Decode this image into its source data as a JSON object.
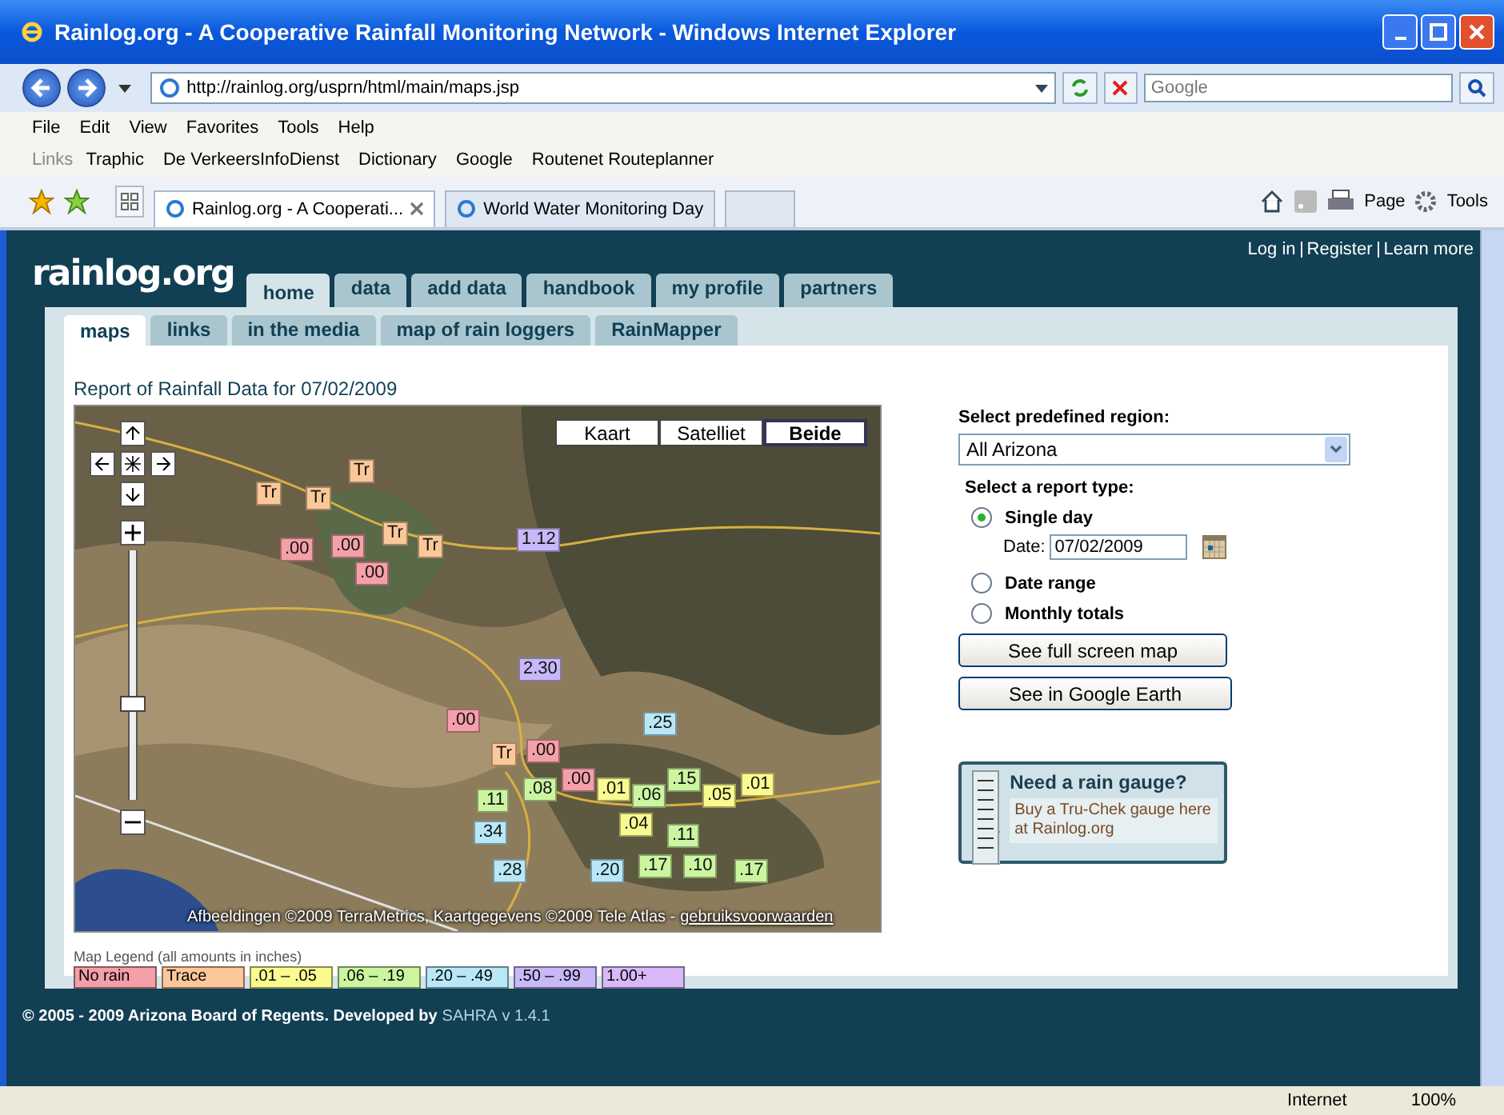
{
  "window": {
    "title": "Rainlog.org - A Cooperative Rainfall Monitoring Network - Windows Internet Explorer"
  },
  "address_bar": {
    "url": "http://rainlog.org/usprn/html/main/maps.jsp"
  },
  "search": {
    "placeholder": "Google"
  },
  "menu": [
    "File",
    "Edit",
    "View",
    "Favorites",
    "Tools",
    "Help"
  ],
  "links_bar": {
    "label": "Links",
    "items": [
      "Traphic",
      "De VerkeersInfoDienst",
      "Dictionary",
      "Google",
      "Routenet Routeplanner"
    ]
  },
  "browser_tabs": [
    {
      "title": "Rainlog.org - A Cooperati...",
      "selected": true
    },
    {
      "title": "World Water Monitoring Day",
      "selected": false
    }
  ],
  "command_bar": [
    "Page",
    "Tools"
  ],
  "site": {
    "logo": "rainlog.org",
    "account_links": [
      "Log in",
      "Register",
      "Learn more"
    ],
    "tabs": [
      {
        "label": "home",
        "selected": true
      },
      {
        "label": "data",
        "selected": false
      },
      {
        "label": "add data",
        "selected": false
      },
      {
        "label": "handbook",
        "selected": false
      },
      {
        "label": "my profile",
        "selected": false
      },
      {
        "label": "partners",
        "selected": false
      }
    ],
    "subtabs": [
      {
        "label": "maps",
        "selected": true
      },
      {
        "label": "links",
        "selected": false
      },
      {
        "label": "in the media",
        "selected": false
      },
      {
        "label": "map of rain loggers",
        "selected": false
      },
      {
        "label": "RainMapper",
        "selected": false
      }
    ]
  },
  "report": {
    "title": "Report of Rainfall Data for 07/02/2009"
  },
  "map": {
    "types": [
      {
        "label": "Kaart",
        "selected": false
      },
      {
        "label": "Satelliet",
        "selected": false
      },
      {
        "label": "Beide",
        "selected": true
      }
    ],
    "zoom": {
      "level": 0.38
    },
    "attribution": "Afbeeldingen ©2009 TerraMetrics, Kaartgegevens ©2009 Tele Atlas -",
    "terms": "gebruiksvoorwaarden",
    "markers": [
      {
        "value": "Tr",
        "color": "#fcc89a"
      },
      {
        "value": "Tr",
        "color": "#fcc89a"
      },
      {
        "value": "Tr",
        "color": "#fcc89a"
      },
      {
        "value": ".00",
        "color": "#f4a0a8"
      },
      {
        "value": ".00",
        "color": "#f4a0a8"
      },
      {
        "value": ".00",
        "color": "#f4a0a8"
      },
      {
        "value": "Tr",
        "color": "#fcc89a"
      },
      {
        "value": "Tr",
        "color": "#fcc89a"
      },
      {
        "value": "1.12",
        "color": "#c8b8f8"
      },
      {
        "value": "2.30",
        "color": "#c8b8f8"
      },
      {
        "value": ".00",
        "color": "#f4a0a8"
      },
      {
        "value": "Tr",
        "color": "#fcc89a"
      },
      {
        "value": ".00",
        "color": "#f4a0a8"
      },
      {
        "value": ".08",
        "color": "#ccf5a0"
      },
      {
        "value": ".00",
        "color": "#f4a0a8"
      },
      {
        "value": ".01",
        "color": "#fafa90"
      },
      {
        "value": ".06",
        "color": "#ccf5a0"
      },
      {
        "value": ".15",
        "color": "#ccf5a0"
      },
      {
        "value": ".05",
        "color": "#fafa90"
      },
      {
        "value": ".01",
        "color": "#fafa90"
      },
      {
        "value": ".25",
        "color": "#b8e8f8"
      },
      {
        "value": ".11",
        "color": "#ccf5a0"
      },
      {
        "value": ".04",
        "color": "#fafa90"
      },
      {
        "value": ".34",
        "color": "#b8e8f8"
      },
      {
        "value": ".11",
        "color": "#ccf5a0"
      },
      {
        "value": ".28",
        "color": "#b8e8f8"
      },
      {
        "value": ".20",
        "color": "#b8e8f8"
      },
      {
        "value": ".17",
        "color": "#ccf5a0"
      },
      {
        "value": ".10",
        "color": "#ccf5a0"
      },
      {
        "value": ".17",
        "color": "#ccf5a0"
      }
    ]
  },
  "legend": {
    "title": "Map Legend (all amounts in inches)",
    "items": [
      {
        "label": "No rain",
        "color": "#f4a0a8"
      },
      {
        "label": "Trace",
        "color": "#fcc89a"
      },
      {
        "label": ".01 – .05",
        "color": "#fafa90"
      },
      {
        "label": ".06 – .19",
        "color": "#ccf5a0"
      },
      {
        "label": ".20 – .49",
        "color": "#b8e8f8"
      },
      {
        "label": ".50 – .99",
        "color": "#c8b8f8"
      },
      {
        "label": "1.00+",
        "color": "#d8b8f8"
      }
    ]
  },
  "form": {
    "region_label": "Select predefined region:",
    "region": "All Arizona",
    "report_label": "Select a report type:",
    "options": [
      {
        "label": "Single day",
        "selected": true
      },
      {
        "label": "Date range",
        "selected": false
      },
      {
        "label": "Monthly totals",
        "selected": false
      }
    ],
    "date_label": "Date:",
    "date": "07/02/2009",
    "buttons": [
      "See full screen map",
      "See in Google Earth"
    ]
  },
  "ad": {
    "title": "Need a rain gauge?",
    "text": "Buy a Tru-Chek gauge here at Rainlog.org"
  },
  "footer": {
    "text": "© 2005 - 2009 Arizona Board of Regents. Developed by",
    "link": "SAHRA",
    "version": "v 1.4.1"
  },
  "status_bar": {
    "zone": "Internet",
    "zoom": "100%"
  }
}
